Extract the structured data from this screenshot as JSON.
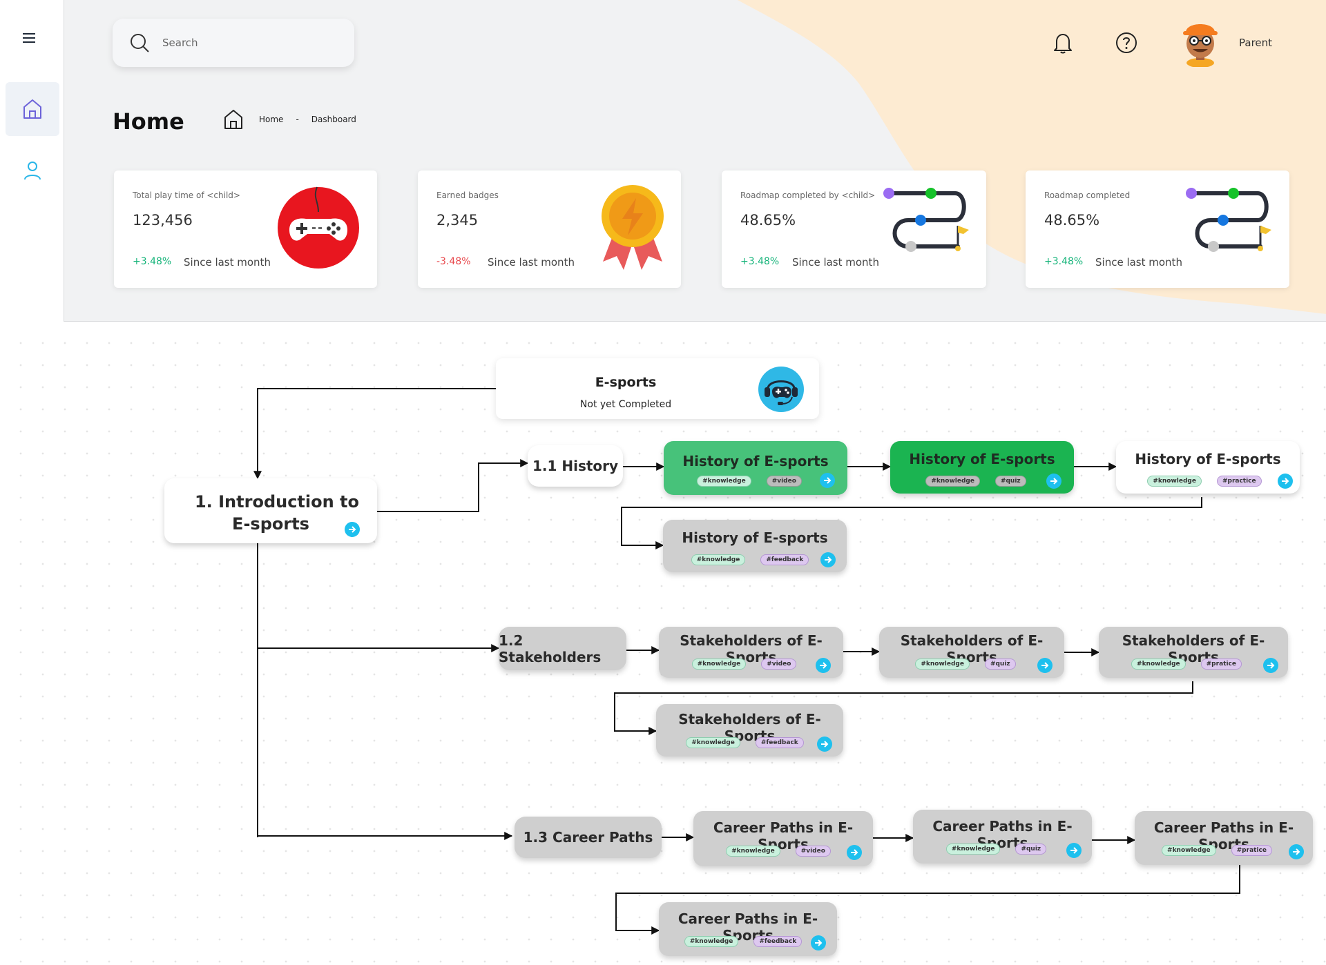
{
  "sidebar": {
    "items": [
      {
        "name": "home",
        "icon": "home-icon",
        "active": true
      },
      {
        "name": "profile",
        "icon": "user-icon",
        "active": false
      }
    ]
  },
  "header": {
    "search_placeholder": "Search",
    "user_name": "Parent",
    "page_title": "Home",
    "breadcrumb": [
      "Home",
      "-",
      "Dashboard"
    ]
  },
  "stats": [
    {
      "label": "Total play time of <child>",
      "value": "123,456",
      "change": "+3.48%",
      "since": "Since last month",
      "trend": "up",
      "icon": "gamepad-icon"
    },
    {
      "label": "Earned badges",
      "value": "2,345",
      "change": "-3.48%",
      "since": "Since last month",
      "trend": "down",
      "icon": "badge-icon"
    },
    {
      "label": "Roadmap completed by <child>",
      "value": "48.65%",
      "change": "+3.48%",
      "since": "Since last month",
      "trend": "up",
      "icon": "roadmap-icon"
    },
    {
      "label": "Roadmap completed",
      "value": "48.65%",
      "change": "+3.48%",
      "since": "Since last month",
      "trend": "up",
      "icon": "roadmap-icon"
    }
  ],
  "roadmap": {
    "main": {
      "title": "E-sports",
      "status": "Not yet Completed",
      "icon": "esports-controller-icon"
    },
    "topic": {
      "title_line1": "1. Introduction to",
      "title_line2": "E-sports"
    },
    "sections": [
      {
        "label": "1.1 History",
        "lessons": [
          {
            "title": "History of E-sports",
            "tags": [
              "#knowledge",
              "#video"
            ]
          },
          {
            "title": "History of E-sports",
            "tags": [
              "#knowledge",
              "#quiz"
            ]
          },
          {
            "title": "History of E-sports",
            "tags": [
              "#knowledge",
              "#practice"
            ]
          },
          {
            "title": "History of E-sports",
            "tags": [
              "#knowledge",
              "#feedback"
            ]
          }
        ]
      },
      {
        "label": "1.2 Stakeholders",
        "lessons": [
          {
            "title": "Stakeholders of E-Sports",
            "tags": [
              "#knowledge",
              "#video"
            ]
          },
          {
            "title": "Stakeholders of E-Sports",
            "tags": [
              "#knowledge",
              "#quiz"
            ]
          },
          {
            "title": "Stakeholders of E-Sports",
            "tags": [
              "#knowledge",
              "#pratice"
            ]
          },
          {
            "title": "Stakeholders of E-Sports",
            "tags": [
              "#knowledge",
              "#feedback"
            ]
          }
        ]
      },
      {
        "label": "1.3 Career Paths",
        "lessons": [
          {
            "title": "Career Paths in E-Sports",
            "tags": [
              "#knowledge",
              "#video"
            ]
          },
          {
            "title": "Career Paths in E-Sports",
            "tags": [
              "#knowledge",
              "#quiz"
            ]
          },
          {
            "title": "Career Paths in E-Sports",
            "tags": [
              "#knowledge",
              "#pratice"
            ]
          },
          {
            "title": "Career Paths in E-Sports",
            "tags": [
              "#knowledge",
              "#feedback"
            ]
          }
        ]
      }
    ]
  },
  "colors": {
    "accent_blue": "#1ec0ee",
    "positive": "#16b47a",
    "negative": "#e8484c",
    "lesson_done": "#47c27a",
    "lesson_done_dark": "#1bb451",
    "lesson_pending": "#cfcfcf",
    "blob": "#fdebd2"
  }
}
